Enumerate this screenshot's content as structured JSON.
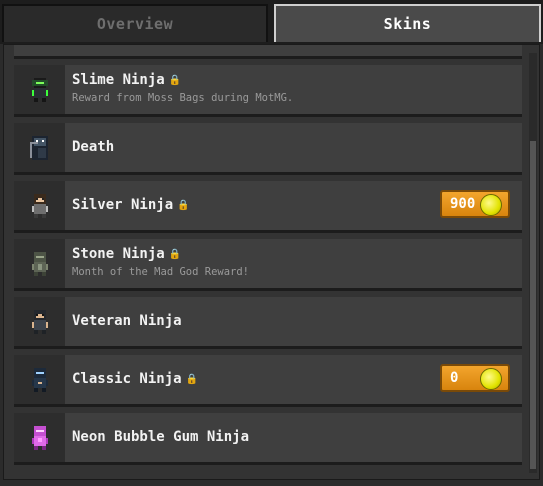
{
  "tabs": [
    {
      "label": "Overview",
      "active": false
    },
    {
      "label": "Skins",
      "active": true
    }
  ],
  "skins": [
    {
      "name": "Slime Ninja",
      "locked": true,
      "desc": "Reward from Moss Bags during MotMG.",
      "price": null,
      "icon": "slime-ninja-sprite"
    },
    {
      "name": "Death",
      "locked": false,
      "desc": "",
      "price": null,
      "icon": "death-sprite"
    },
    {
      "name": "Silver Ninja",
      "locked": true,
      "desc": "",
      "price": "900",
      "icon": "silver-ninja-sprite"
    },
    {
      "name": "Stone Ninja",
      "locked": true,
      "desc": "Month of the Mad God Reward!",
      "price": null,
      "icon": "stone-ninja-sprite"
    },
    {
      "name": "Veteran Ninja",
      "locked": false,
      "desc": "",
      "price": null,
      "icon": "veteran-ninja-sprite"
    },
    {
      "name": "Classic Ninja",
      "locked": true,
      "desc": "",
      "price": "0",
      "icon": "classic-ninja-sprite"
    },
    {
      "name": "Neon Bubble Gum Ninja",
      "locked": false,
      "desc": "",
      "price": null,
      "icon": "neon-bubble-gum-ninja-sprite"
    }
  ],
  "colors": {
    "price_button": "#f0a02a",
    "coin": "#e4e600",
    "active_tab_border": "#cfcfcf"
  }
}
